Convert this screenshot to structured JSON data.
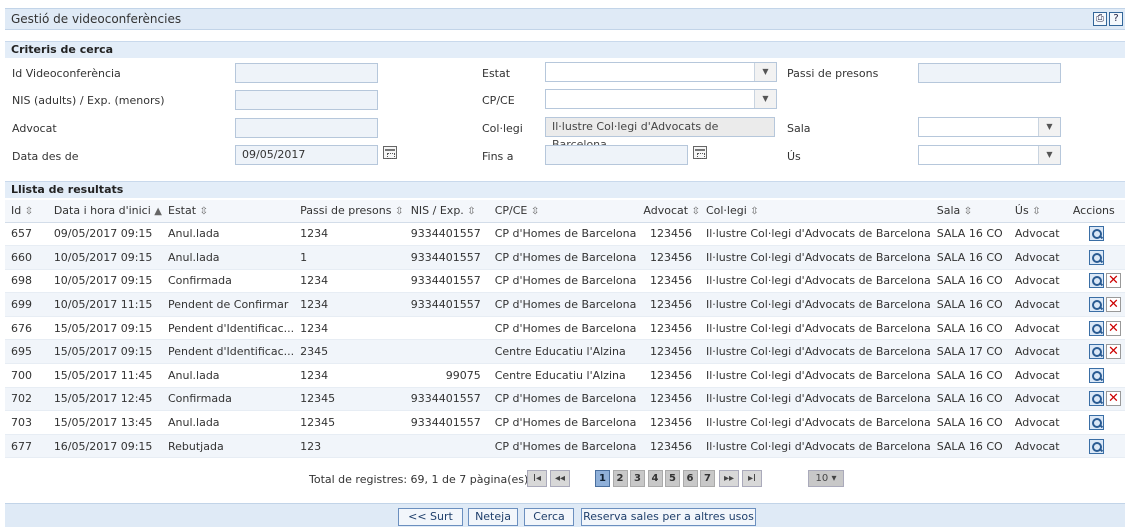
{
  "title": "Gestió de videoconferències",
  "toolbar": {
    "print_icon": "printer-icon",
    "help_label": "?"
  },
  "criteria": {
    "header": "Criteris de cerca",
    "id_label": "Id Videoconferència",
    "id_value": "",
    "estat_label": "Estat",
    "estat_value": "",
    "passi_label": "Passi de presons",
    "passi_value": "",
    "nis_label": "NIS (adults) / Exp. (menors)",
    "nis_value": "",
    "cpce_label": "CP/CE",
    "cpce_value": "",
    "advocat_label": "Advocat",
    "advocat_value": "",
    "collegi_label": "Col·legi",
    "collegi_value": "Il·lustre Col·legi d'Advocats de Barcelona",
    "sala_label": "Sala",
    "sala_value": "",
    "data_label": "Data des de",
    "data_value": "09/05/2017",
    "fins_label": "Fins a",
    "fins_value": "",
    "us_label": "Ús",
    "us_value": ""
  },
  "results": {
    "header": "Llista de resultats",
    "columns": [
      "Id",
      "Data i hora d'inici",
      "Estat",
      "Passi de presons",
      "NIS / Exp.",
      "CP/CE",
      "Advocat",
      "Col·legi",
      "Sala",
      "Ús",
      "Accions"
    ],
    "sort_icons": {
      "neutral": "⇳",
      "asc": "▲"
    },
    "rows": [
      {
        "id": "657",
        "data": "09/05/2017 09:15",
        "estat": "Anul.lada",
        "passi": "1234",
        "nis": "9334401557",
        "cpce": "CP d'Homes de Barcelona",
        "advocat": "123456",
        "collegi": "Il·lustre Col·legi d'Advocats de Barcelona",
        "sala": "SALA 16 CO",
        "us": "Advocat",
        "del": false
      },
      {
        "id": "660",
        "data": "10/05/2017 09:15",
        "estat": "Anul.lada",
        "passi": "1",
        "nis": "9334401557",
        "cpce": "CP d'Homes de Barcelona",
        "advocat": "123456",
        "collegi": "Il·lustre Col·legi d'Advocats de Barcelona",
        "sala": "SALA 16 CO",
        "us": "Advocat",
        "del": false
      },
      {
        "id": "698",
        "data": "10/05/2017 09:15",
        "estat": "Confirmada",
        "passi": "1234",
        "nis": "9334401557",
        "cpce": "CP d'Homes de Barcelona",
        "advocat": "123456",
        "collegi": "Il·lustre Col·legi d'Advocats de Barcelona",
        "sala": "SALA 16 CO",
        "us": "Advocat",
        "del": true
      },
      {
        "id": "699",
        "data": "10/05/2017 11:15",
        "estat": "Pendent de Confirmar",
        "passi": "1234",
        "nis": "9334401557",
        "cpce": "CP d'Homes de Barcelona",
        "advocat": "123456",
        "collegi": "Il·lustre Col·legi d'Advocats de Barcelona",
        "sala": "SALA 16 CO",
        "us": "Advocat",
        "del": true
      },
      {
        "id": "676",
        "data": "15/05/2017 09:15",
        "estat": "Pendent d'Identificac...",
        "passi": "1234",
        "nis": "",
        "cpce": "CP d'Homes de Barcelona",
        "advocat": "123456",
        "collegi": "Il·lustre Col·legi d'Advocats de Barcelona",
        "sala": "SALA 16 CO",
        "us": "Advocat",
        "del": true
      },
      {
        "id": "695",
        "data": "15/05/2017 09:15",
        "estat": "Pendent d'Identificac...",
        "passi": "2345",
        "nis": "",
        "cpce": "Centre Educatiu l'Alzina",
        "advocat": "123456",
        "collegi": "Il·lustre Col·legi d'Advocats de Barcelona",
        "sala": "SALA 17 CO",
        "us": "Advocat",
        "del": true
      },
      {
        "id": "700",
        "data": "15/05/2017 11:45",
        "estat": "Anul.lada",
        "passi": "1234",
        "nis": "99075",
        "cpce": "Centre Educatiu l'Alzina",
        "advocat": "123456",
        "collegi": "Il·lustre Col·legi d'Advocats de Barcelona",
        "sala": "SALA 16 CO",
        "us": "Advocat",
        "del": false
      },
      {
        "id": "702",
        "data": "15/05/2017 12:45",
        "estat": "Confirmada",
        "passi": "12345",
        "nis": "9334401557",
        "cpce": "CP d'Homes de Barcelona",
        "advocat": "123456",
        "collegi": "Il·lustre Col·legi d'Advocats de Barcelona",
        "sala": "SALA 16 CO",
        "us": "Advocat",
        "del": true
      },
      {
        "id": "703",
        "data": "15/05/2017 13:45",
        "estat": "Anul.lada",
        "passi": "12345",
        "nis": "9334401557",
        "cpce": "CP d'Homes de Barcelona",
        "advocat": "123456",
        "collegi": "Il·lustre Col·legi d'Advocats de Barcelona",
        "sala": "SALA 16 CO",
        "us": "Advocat",
        "del": false
      },
      {
        "id": "677",
        "data": "16/05/2017 09:15",
        "estat": "Rebutjada",
        "passi": "123",
        "nis": "",
        "cpce": "CP d'Homes de Barcelona",
        "advocat": "123456",
        "collegi": "Il·lustre Col·legi d'Advocats de Barcelona",
        "sala": "SALA 16 CO",
        "us": "Advocat",
        "del": false
      }
    ]
  },
  "pager": {
    "total": "Total de registres: 69, 1 de 7 pàgina(es)",
    "first": "I◂",
    "prev": "◂◂",
    "pages": [
      "1",
      "2",
      "3",
      "4",
      "5",
      "6",
      "7"
    ],
    "current": "1",
    "next": "▸▸",
    "last": "▸I",
    "page_size": "10"
  },
  "footer": {
    "back": "<< Surt",
    "clear": "Neteja",
    "search": "Cerca",
    "reserve": "Reserva sales per a altres usos"
  }
}
